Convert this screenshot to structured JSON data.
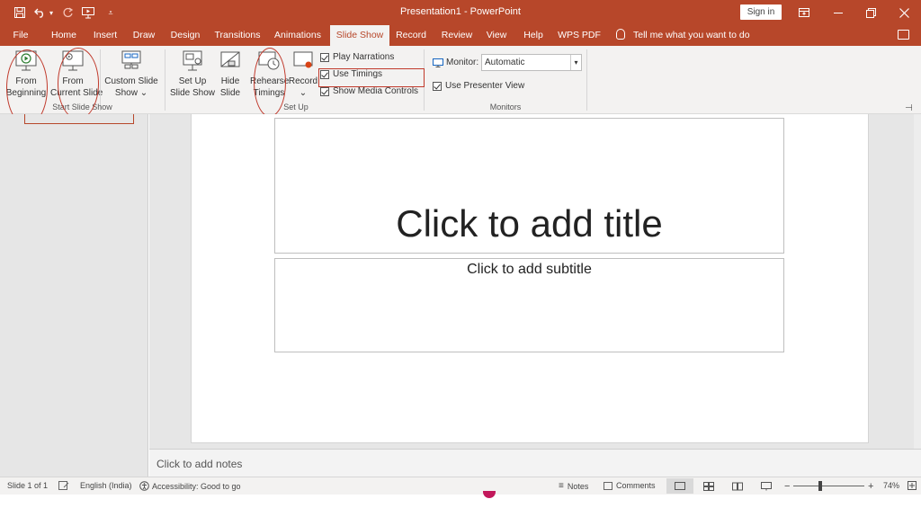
{
  "app": {
    "window_title": "Presentation1  -  PowerPoint",
    "sign_in_label": "Sign in",
    "accent_color": "#b7472a"
  },
  "quick_access": {
    "icons": [
      "save-icon",
      "undo-icon",
      "redo-icon",
      "start-from-beginning-icon",
      "customize-icon"
    ]
  },
  "tabs": [
    {
      "label": "File"
    },
    {
      "label": "Home"
    },
    {
      "label": "Insert"
    },
    {
      "label": "Draw"
    },
    {
      "label": "Design"
    },
    {
      "label": "Transitions"
    },
    {
      "label": "Animations"
    },
    {
      "label": "Slide Show",
      "active": true
    },
    {
      "label": "Record"
    },
    {
      "label": "Review"
    },
    {
      "label": "View"
    },
    {
      "label": "Help"
    },
    {
      "label": "WPS PDF"
    }
  ],
  "tell_me": "Tell me what you want to do",
  "ribbon": {
    "start_slide_show": {
      "group_label": "Start Slide Show",
      "from_beginning": {
        "line1": "From",
        "line2": "Beginning"
      },
      "from_current": {
        "line1": "From",
        "line2": "Current Slide"
      },
      "custom_show": {
        "line1": "Custom Slide",
        "line2": "Show ⌄"
      }
    },
    "set_up": {
      "group_label": "Set Up",
      "set_up_show": {
        "line1": "Set Up",
        "line2": "Slide Show"
      },
      "hide_slide": {
        "line1": "Hide",
        "line2": "Slide"
      },
      "rehearse": {
        "line1": "Rehearse",
        "line2": "Timings"
      },
      "record": {
        "line1": "Record",
        "line2": "⌄"
      },
      "play_narrations": "Play Narrations",
      "use_timings": "Use Timings",
      "show_media_controls": "Show Media Controls"
    },
    "monitors": {
      "group_label": "Monitors",
      "monitor_label": "Monitor:",
      "monitor_value": "Automatic",
      "use_presenter_view": "Use Presenter View"
    }
  },
  "slide": {
    "title_placeholder": "Click to add title",
    "subtitle_placeholder": "Click to add subtitle"
  },
  "notes_placeholder": "Click to add notes",
  "status": {
    "slide_counter": "Slide 1 of 1",
    "language": "English (India)",
    "accessibility": "Accessibility: Good to go",
    "notes_label": "Notes",
    "comments_label": "Comments",
    "zoom_minus": "−",
    "zoom_plus": "+",
    "zoom_level": "74%"
  }
}
